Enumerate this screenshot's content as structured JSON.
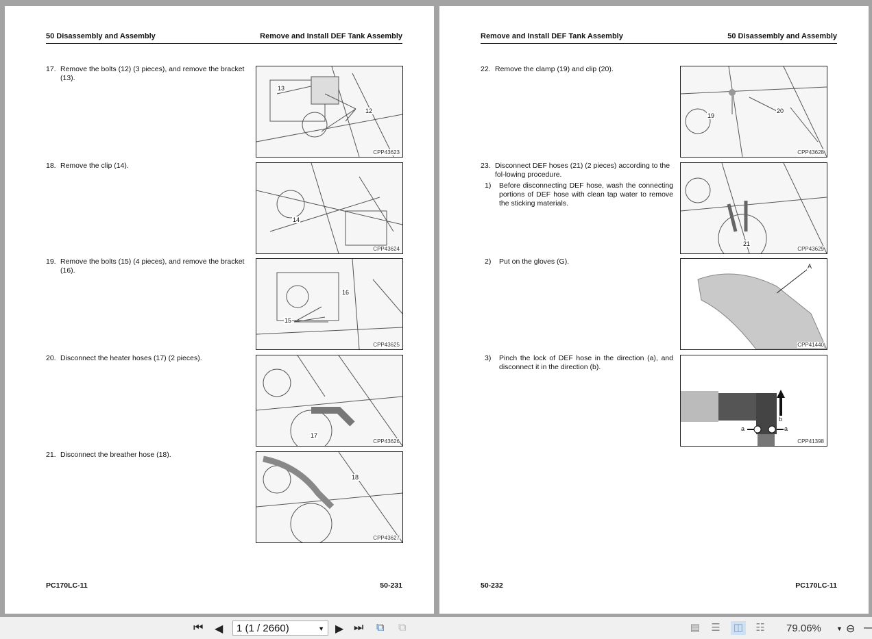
{
  "left_page": {
    "header_left": "50 Disassembly and Assembly",
    "header_right": "Remove and Install DEF Tank Assembly",
    "steps": [
      {
        "num": "17.",
        "text": "Remove the bolts (12) (3 pieces), and remove the bracket (13).",
        "figure": {
          "code": "CPP43623",
          "labels": [
            "13",
            "12"
          ]
        }
      },
      {
        "num": "18.",
        "text": "Remove the clip (14).",
        "figure": {
          "code": "CPP43624",
          "labels": [
            "14"
          ]
        }
      },
      {
        "num": "19.",
        "text": "Remove the bolts (15) (4 pieces), and remove the bracket (16).",
        "figure": {
          "code": "CPP43625",
          "labels": [
            "16",
            "15"
          ]
        }
      },
      {
        "num": "20.",
        "text": "Disconnect the heater hoses (17) (2 pieces).",
        "figure": {
          "code": "CPP43626",
          "labels": [
            "17"
          ]
        }
      },
      {
        "num": "21.",
        "text": "Disconnect the breather hose (18).",
        "figure": {
          "code": "CPP43627",
          "labels": [
            "18"
          ]
        }
      }
    ],
    "footer_left": "PC170LC-11",
    "footer_right": "50-231"
  },
  "right_page": {
    "header_left": "Remove and Install DEF Tank Assembly",
    "header_right": "50 Disassembly and Assembly",
    "steps": [
      {
        "num": "22.",
        "text": "Remove the clamp (19) and clip (20).",
        "figure": {
          "code": "CPP43628",
          "labels": [
            "19",
            "20"
          ]
        }
      },
      {
        "num": "23.",
        "text": "Disconnect DEF hoses (21) (2 pieces) according to the fol-lowing procedure.",
        "figure": {
          "code": "CPP43629",
          "labels": [
            "21"
          ]
        }
      }
    ],
    "substeps": [
      {
        "num": "1)",
        "text": "Before disconnecting DEF hose, wash the connecting portions of DEF hose with clean tap water to remove the sticking materials."
      },
      {
        "num": "2)",
        "text": "Put on the gloves (G).",
        "figure": {
          "code": "CPP41440",
          "labels": [
            "A"
          ]
        }
      },
      {
        "num": "3)",
        "text": "Pinch the lock of DEF hose in the direction (a), and disconnect it in the direction (b).",
        "figure": {
          "code": "CPP41398",
          "labels": [
            "a",
            "a",
            "b"
          ]
        }
      }
    ],
    "footer_left": "50-232",
    "footer_right": "PC170LC-11"
  },
  "toolbar": {
    "page_value": "1 (1 / 2660)",
    "zoom": "79.06%"
  }
}
